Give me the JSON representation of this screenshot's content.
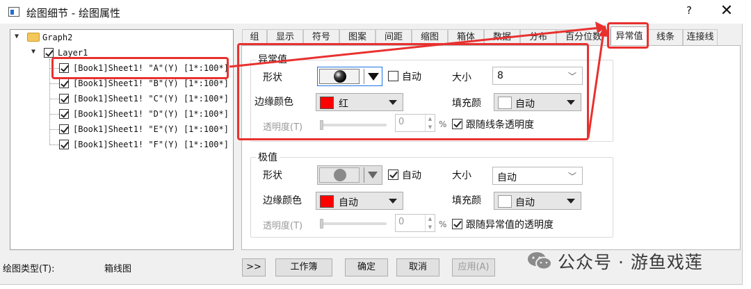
{
  "window": {
    "title": "绘图细节 - 绘图属性",
    "help": "?",
    "close": "✕"
  },
  "tree": {
    "root": "Graph2",
    "layer": "Layer1",
    "items": [
      "[Book1]Sheet1! \"A\"(Y) [1*:100*]",
      "[Book1]Sheet1! \"B\"(Y) [1*:100*]",
      "[Book1]Sheet1! \"C\"(Y) [1*:100*]",
      "[Book1]Sheet1! \"D\"(Y) [1*:100*]",
      "[Book1]Sheet1! \"E\"(Y) [1*:100*]",
      "[Book1]Sheet1! \"F\"(Y) [1*:100*]"
    ]
  },
  "plot_type": {
    "label": "绘图类型(T):",
    "value": "箱线图"
  },
  "tabs": [
    "组",
    "显示",
    "符号",
    "图案",
    "间距",
    "缩图",
    "箱体",
    "数据",
    "分布",
    "百分位数",
    "异常值",
    "线条",
    "连接线"
  ],
  "active_tab": "异常值",
  "outliers": {
    "title": "异常值",
    "shape_label": "形状",
    "auto_label": "自动",
    "size_label": "大小",
    "size_value": "8",
    "edge_color_label": "边缘颜色",
    "edge_color_value": "红",
    "edge_color_hex": "#ff0000",
    "fill_label": "填充颜",
    "fill_value": "自动",
    "transparency_label": "透明度(T)",
    "transparency_value": "0",
    "percent": "%",
    "follow_label": "跟随线条透明度",
    "auto_checked": false,
    "follow_checked": true
  },
  "extremes": {
    "title": "极值",
    "shape_label": "形状",
    "auto_label": "自动",
    "size_label": "大小",
    "size_value": "自动",
    "edge_color_label": "边缘颜色",
    "edge_color_value": "自动",
    "edge_color_hex": "#ff0000",
    "fill_label": "填充颜",
    "fill_value": "自动",
    "transparency_label": "透明度(T)",
    "transparency_value": "0",
    "percent": "%",
    "follow_label": "跟随异常值的透明度",
    "auto_checked": true,
    "follow_checked": true
  },
  "buttons": {
    "more": ">>",
    "workbook": "工作簿",
    "ok": "确定",
    "cancel": "取消",
    "apply": "应用(A)"
  },
  "watermark": "公众号 · 游鱼戏莲",
  "colors": {
    "annotation_red": "#e8312f",
    "accent_blue": "#1a73e8"
  }
}
